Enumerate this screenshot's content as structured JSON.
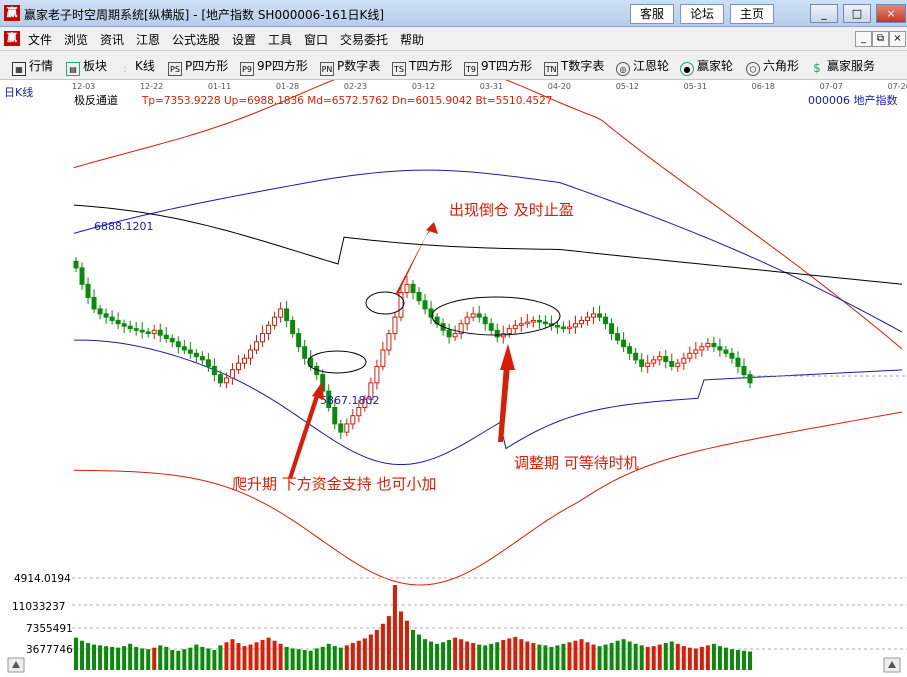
{
  "window": {
    "title": "赢家老子时空周期系统[纵横版] - [地产指数  SH000006-161日K线]",
    "buttons": [
      "客服",
      "论坛",
      "主页"
    ],
    "controls": [
      "_",
      "□",
      "×"
    ]
  },
  "menu": {
    "items": [
      "文件",
      "浏览",
      "资讯",
      "江恩",
      "公式选股",
      "设置",
      "工具",
      "窗口",
      "交易委托",
      "帮助"
    ],
    "mdi_controls": [
      "_",
      "⧉",
      "×"
    ]
  },
  "toolbar": {
    "items": [
      {
        "label": "行情",
        "icon": "grid-icon"
      },
      {
        "label": "板块",
        "icon": "blocks-icon"
      },
      {
        "label": "K线",
        "icon": "candlestick-icon"
      },
      {
        "label": "P四方形",
        "icon": "ps-icon",
        "tag": "PS"
      },
      {
        "label": "9P四方形",
        "icon": "p9-icon",
        "tag": "P9"
      },
      {
        "label": "P数字表",
        "icon": "pn-icon",
        "tag": "PN"
      },
      {
        "label": "T四方形",
        "icon": "ts-icon",
        "tag": "TS"
      },
      {
        "label": "9T四方形",
        "icon": "t9-icon",
        "tag": "T9"
      },
      {
        "label": "T数字表",
        "icon": "tn-icon",
        "tag": "TN"
      },
      {
        "label": "江恩轮",
        "icon": "gann-wheel-icon"
      },
      {
        "label": "赢家轮",
        "icon": "winner-wheel-icon"
      },
      {
        "label": "六角形",
        "icon": "hexagon-icon"
      },
      {
        "label": "赢家服务",
        "icon": "dollar-icon"
      }
    ]
  },
  "chart": {
    "period_label": "日K线",
    "dates": [
      "12-03",
      "12-22",
      "01-11",
      "01-28",
      "02-23",
      "03-12",
      "03-31",
      "04-20",
      "05-12",
      "05-31",
      "06-18",
      "07-07",
      "07-26"
    ],
    "indicator_name": "极反通道",
    "indicator_values": "Tp=7353.9228  Up=6988.1836  Md=6572.5762  Dn=6015.9042  Bt=5510.4527",
    "symbol": "000006  地产指数",
    "high_label": "6888.1201",
    "low_label": "5867.1802",
    "annotations": {
      "top": "出现倒仓 及时止盈",
      "bottom_left": "爬升期 下方资金支持 也可小加",
      "bottom_right": "调整期 可等待时机"
    },
    "volume_labels": [
      "4914.0194",
      "11033237",
      "7355491",
      "3677746"
    ],
    "colors": {
      "up": "#d81e06",
      "down": "#0a8a0a",
      "outer_band": "#d81e06",
      "inner_band": "#1a1aaa",
      "mid_line": "#000000",
      "annotation": "#d81e06"
    }
  },
  "chart_data": {
    "type": "candlestick",
    "title": "地产指数 日K线",
    "ylim": [
      5000,
      7800
    ],
    "close": [
      6900,
      6800,
      6720,
      6650,
      6620,
      6600,
      6580,
      6560,
      6545,
      6530,
      6520,
      6510,
      6500,
      6520,
      6490,
      6470,
      6450,
      6420,
      6400,
      6380,
      6360,
      6340,
      6300,
      6250,
      6200,
      6230,
      6280,
      6320,
      6350,
      6400,
      6450,
      6500,
      6550,
      6600,
      6650,
      6580,
      6500,
      6420,
      6350,
      6300,
      6250,
      6150,
      6050,
      5950,
      5900,
      5950,
      6000,
      6050,
      6100,
      6200,
      6300,
      6400,
      6500,
      6600,
      6750,
      6800,
      6750,
      6700,
      6650,
      6600,
      6560,
      6520,
      6480,
      6500,
      6560,
      6600,
      6620,
      6600,
      6560,
      6520,
      6480,
      6500,
      6530,
      6550,
      6560,
      6570,
      6580,
      6570,
      6560,
      6550,
      6540,
      6530,
      6540,
      6560,
      6580,
      6600,
      6620,
      6600,
      6560,
      6500,
      6460,
      6420,
      6380,
      6340,
      6300,
      6320,
      6340,
      6360,
      6330,
      6300,
      6320,
      6350,
      6380,
      6400,
      6420,
      6440,
      6420,
      6400,
      6380,
      6350,
      6300,
      6250,
      6200
    ],
    "volume": [
      4200000,
      3800000,
      3500000,
      3300000,
      3200000,
      3100000,
      3000000,
      2900000,
      3100000,
      3400000,
      3000000,
      2800000,
      2700000,
      2900000,
      3200000,
      3000000,
      2600000,
      2500000,
      2700000,
      2900000,
      3300000,
      3000000,
      2800000,
      2600000,
      3200000,
      3600000,
      4000000,
      3500000,
      3100000,
      3300000,
      3600000,
      3900000,
      4200000,
      3800000,
      3400000,
      3000000,
      2800000,
      2700000,
      2600000,
      2500000,
      2800000,
      3000000,
      3400000,
      3100000,
      2900000,
      3200000,
      3500000,
      3800000,
      4100000,
      4600000,
      5200000,
      6000000,
      7000000,
      11033237,
      7600000,
      6400000,
      5200000,
      4600000,
      4000000,
      3700000,
      3400000,
      3600000,
      3900000,
      4200000,
      4000000,
      3700000,
      3500000,
      3300000,
      3200000,
      3400000,
      3600000,
      3900000,
      4100000,
      4300000,
      4000000,
      3700000,
      3500000,
      3300000,
      3200000,
      3000000,
      3200000,
      3400000,
      3600000,
      3800000,
      4000000,
      3600000,
      3300000,
      3100000,
      3300000,
      3500000,
      3800000,
      4000000,
      3700000,
      3400000,
      3200000,
      3000000,
      3100000,
      3300000,
      3500000,
      3700000,
      3400000,
      3100000,
      2900000,
      2800000,
      3000000,
      3200000,
      3400000,
      3100000,
      2900000,
      2700000,
      2600000,
      2500000,
      2400000
    ]
  }
}
